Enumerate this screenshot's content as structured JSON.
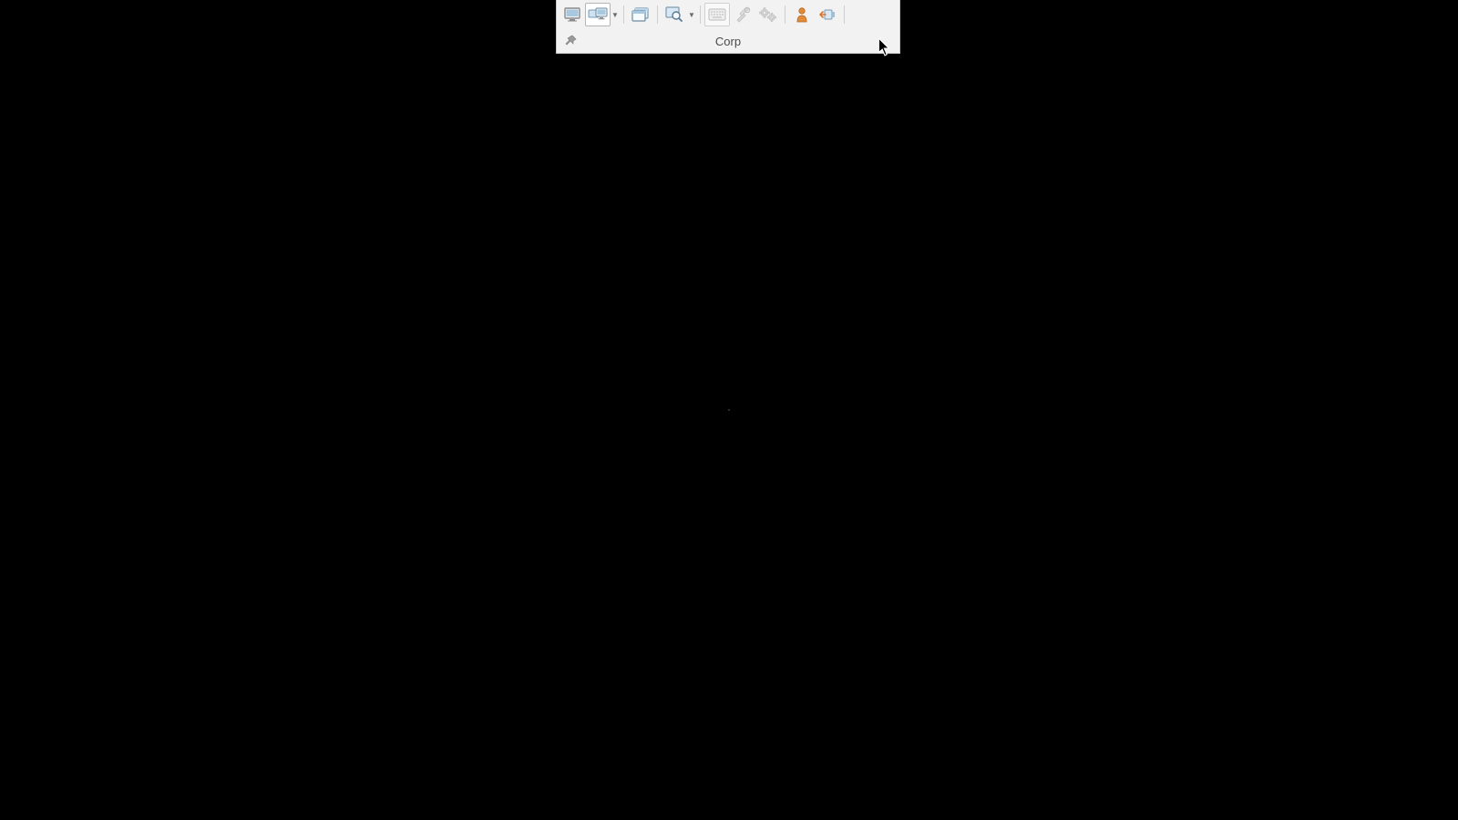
{
  "toolbar": {
    "title": "Corp",
    "icons": {
      "monitor": "monitor-icon",
      "monitors": "multi-monitor-icon",
      "window": "window-icon",
      "zoom": "zoom-icon",
      "keyboard": "keyboard-icon",
      "tools": "tools-icon",
      "gears": "settings-gears-icon",
      "user": "user-icon",
      "disconnect": "disconnect-icon",
      "pin": "pin-icon"
    },
    "colors": {
      "panel_bg": "#f2f2f2",
      "panel_border": "#c8c8c8",
      "icon_gray": "#7d7d7d",
      "icon_blue": "#4d8bbf",
      "icon_orange": "#d97a2e",
      "active_bg": "#ffffff",
      "active_border": "#b5b5b5"
    }
  }
}
